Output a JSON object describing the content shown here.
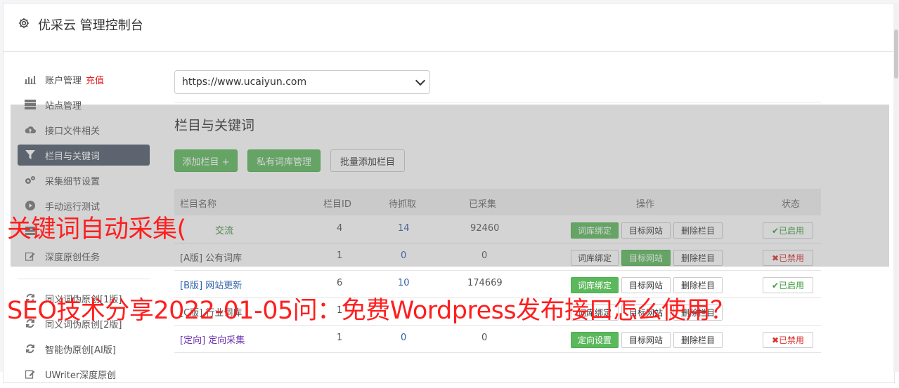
{
  "header": {
    "title": "优采云 管理控制台"
  },
  "sidebar": {
    "items": [
      {
        "label": "账户管理",
        "extra": "充值",
        "icon": "bar-chart-icon"
      },
      {
        "label": "站点管理",
        "icon": "server-icon"
      },
      {
        "label": "接口文件相关",
        "icon": "cloud-upload-icon"
      },
      {
        "label": "栏目与关键词",
        "icon": "filter-icon",
        "active": true
      },
      {
        "label": "采集细节设置",
        "icon": "cogs-icon"
      },
      {
        "label": "手动运行测试",
        "icon": "play-circle-icon"
      },
      {
        "label": "",
        "icon": "list-icon"
      },
      {
        "label": "深度原创任务",
        "icon": "edit-icon"
      },
      {
        "label": "同义词伪原创[1版]",
        "icon": "refresh-icon"
      },
      {
        "label": "同义词伪原创[2版]",
        "icon": "refresh-icon"
      },
      {
        "label": "智能伪原创[AI版]",
        "icon": "refresh-icon"
      },
      {
        "label": "UWriter深度原创",
        "icon": "edit-icon"
      }
    ]
  },
  "main": {
    "site_select": {
      "value": "https://www.ucaiyun.com"
    },
    "section_title": "栏目与关键词",
    "buttons": {
      "add_column": "添加栏目 +",
      "private_lexicon": "私有词库管理",
      "batch_add": "批量添加栏目"
    },
    "table": {
      "headers": {
        "name": "栏目名称",
        "id": "栏目ID",
        "pending": "待抓取",
        "collected": "已采集",
        "ops": "操作",
        "status": "状态"
      },
      "rows": [
        {
          "name": "交流",
          "id": "4",
          "pending": "14",
          "collected": "92460",
          "op1": "词库绑定",
          "op2": "目标网站",
          "op3": "删除栏目",
          "status": "已启用"
        },
        {
          "name": "[A版] 公有词库",
          "id": "1",
          "pending": "0",
          "collected": "0",
          "op1": "词库绑定",
          "op2": "目标网站",
          "op3": "删除栏目",
          "status": "已禁用"
        },
        {
          "name": "[B版] 网站更新",
          "id": "6",
          "pending": "10",
          "collected": "174669",
          "op1": "词库绑定",
          "op2": "目标网站",
          "op3": "删除栏目",
          "status": "已启用"
        },
        {
          "name": "[C版] 行业词库",
          "id": "1",
          "pending": "",
          "collected": "",
          "op1": "词库绑定",
          "op2": "目标网站",
          "op3": "删除栏目",
          "status": ""
        },
        {
          "name": "[定向] 定向采集",
          "id": "1",
          "pending": "0",
          "collected": "0",
          "op1": "定向设置",
          "op2": "目标网站",
          "op3": "删除栏目",
          "status": "已禁用"
        }
      ]
    }
  },
  "captions": {
    "line1": "关键词自动采集(",
    "line2": "SEO技术分享2022-01-05问：免费Wordpress发布接口怎么使用？"
  },
  "colors": {
    "accent_green": "#5cb85c",
    "sidebar_active": "#4e5b6a",
    "caption_red": "#ff1e1e"
  }
}
